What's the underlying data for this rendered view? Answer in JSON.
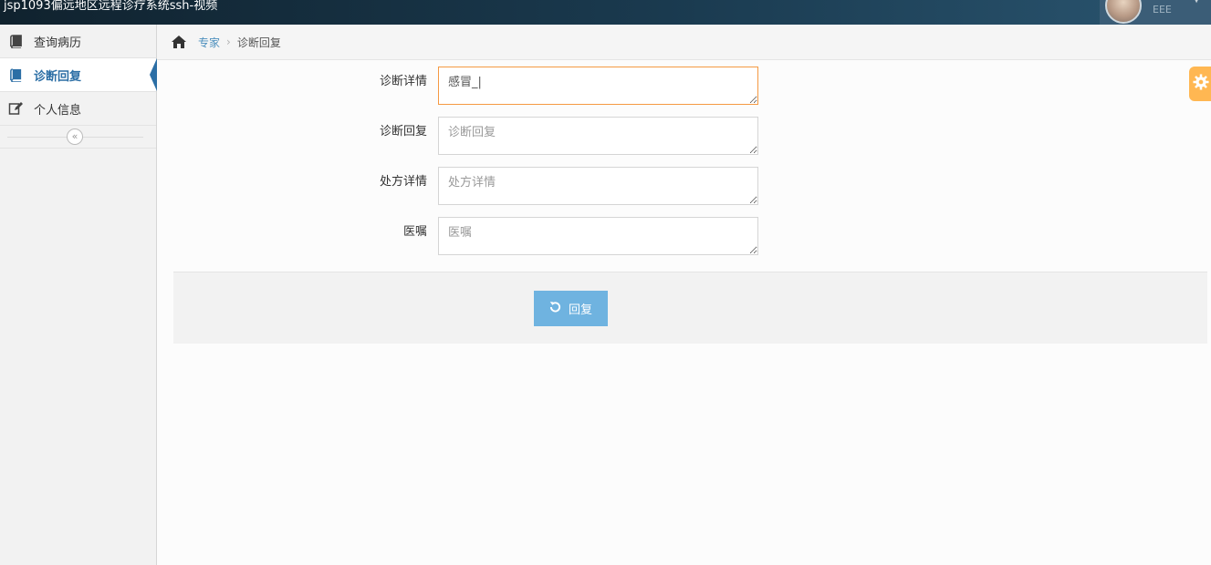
{
  "window": {
    "title": "jsp1093偏远地区远程诊疗系统ssh-视频"
  },
  "user": {
    "name": "EEE"
  },
  "sidebar": {
    "items": [
      {
        "label": "查询病历",
        "icon": "book-icon"
      },
      {
        "label": "诊断回复",
        "icon": "book-icon",
        "active": true
      },
      {
        "label": "个人信息",
        "icon": "edit-icon"
      }
    ],
    "collapse_icon": "double-chevron-left-icon"
  },
  "breadcrumb": {
    "home_icon": "home-icon",
    "parent": "专家",
    "current": "诊断回复"
  },
  "form": {
    "fields": [
      {
        "label": "诊断详情",
        "value": "感冒_|",
        "placeholder": ""
      },
      {
        "label": "诊断回复",
        "value": "",
        "placeholder": "诊断回复"
      },
      {
        "label": "处方详情",
        "value": "",
        "placeholder": "处方详情"
      },
      {
        "label": "医嘱",
        "value": "",
        "placeholder": "医嘱"
      }
    ],
    "submit_label": "回复",
    "submit_icon": "undo-icon"
  },
  "colors": {
    "accent": "#2b6ea5",
    "link": "#4c8fbd",
    "button": "#6fb3e0",
    "focus_border": "#f59942",
    "settings_tab": "#ffb752"
  }
}
